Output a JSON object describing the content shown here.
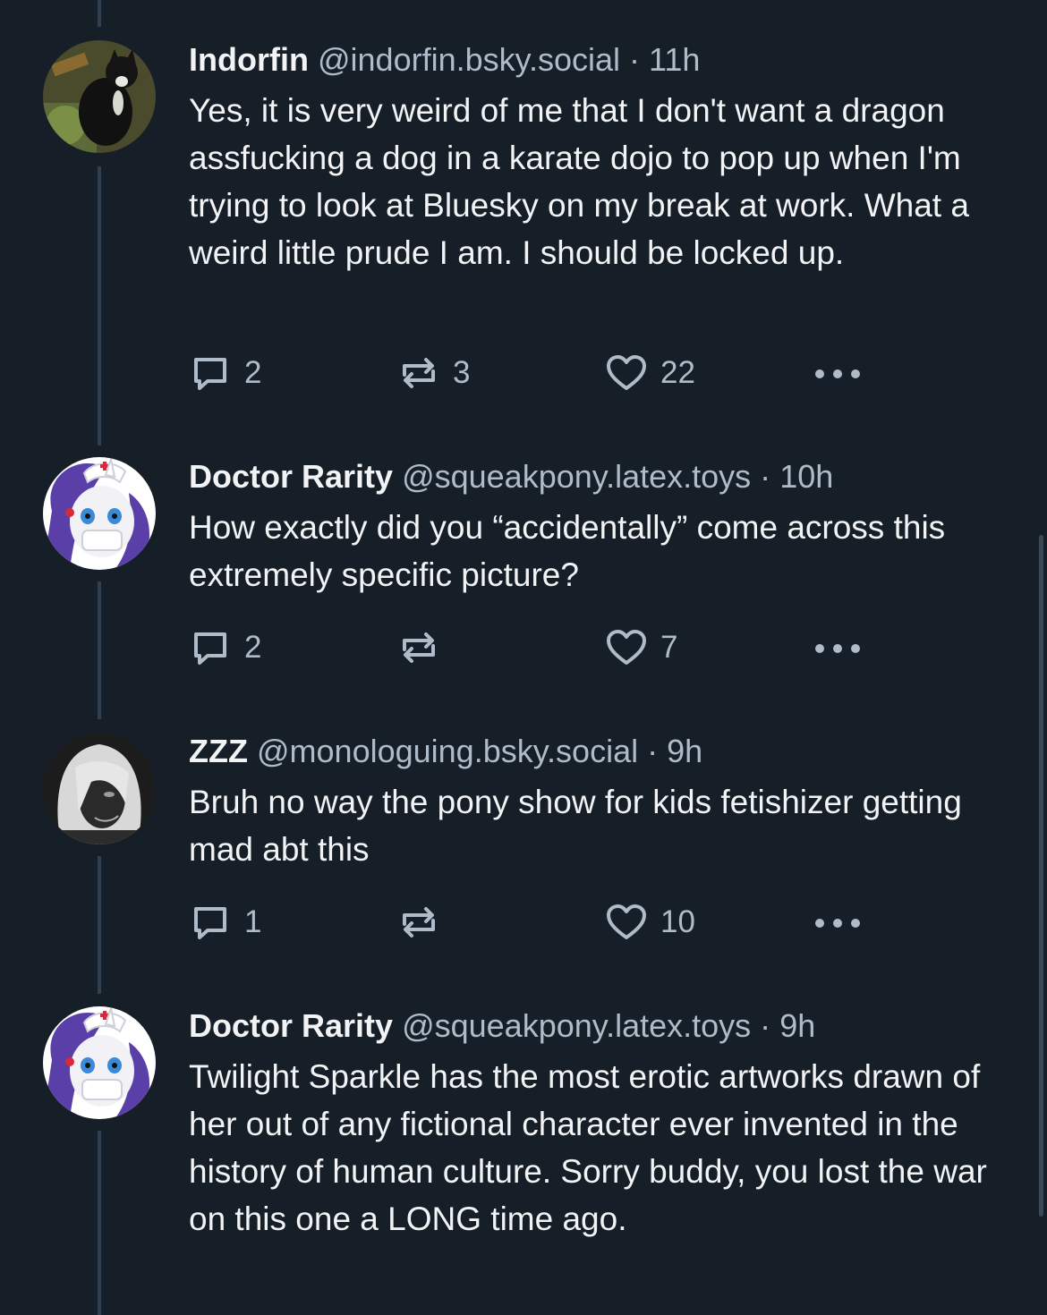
{
  "colors": {
    "background": "#161e27",
    "text": "#f1f3f5",
    "muted": "#aebbc9",
    "thread_line": "#2e4052"
  },
  "posts": [
    {
      "display_name": "Indorfin",
      "handle": "@indorfin.bsky.social",
      "separator": "·",
      "time": "11h",
      "text": "Yes, it is very weird of me that I don't want a dragon assfucking a dog in a karate dojo to pop up when I'm trying to look at Bluesky on my break at work. What a weird little prude I am. I should be locked up.",
      "replies": "2",
      "reposts": "3",
      "likes": "22",
      "avatar_icon": "cat-avatar"
    },
    {
      "display_name": "Doctor Rarity",
      "handle": "@squeakpony.latex.toys",
      "separator": "·",
      "time": "10h",
      "text": "How exactly did you “accidentally” come across this extremely specific picture?",
      "replies": "2",
      "reposts": "",
      "likes": "7",
      "avatar_icon": "pony-nurse-avatar"
    },
    {
      "display_name": "ZZZ",
      "handle": "@monologuing.bsky.social",
      "separator": "·",
      "time": "9h",
      "text": "Bruh no way the pony show for kids fetishizer getting mad abt this",
      "replies": "1",
      "reposts": "",
      "likes": "10",
      "avatar_icon": "white-hair-avatar"
    },
    {
      "display_name": "Doctor Rarity",
      "handle": "@squeakpony.latex.toys",
      "separator": "·",
      "time": "9h",
      "text": "Twilight Sparkle has the most erotic artworks drawn of her out of any fictional character ever invented in the history of human culture. Sorry buddy, you lost the war on this one a LONG time ago.",
      "avatar_icon": "pony-nurse-avatar"
    }
  ]
}
